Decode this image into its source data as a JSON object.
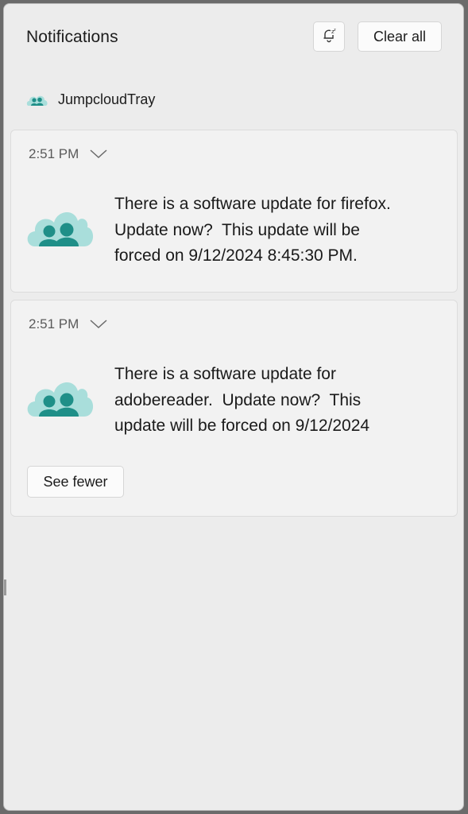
{
  "header": {
    "title": "Notifications",
    "clear_all_label": "Clear all",
    "dnd_icon": "snooze-bell-icon"
  },
  "app": {
    "name": "JumpcloudTray",
    "icon": "jumpcloud-icon",
    "accent_color": "#2fa29a"
  },
  "notifications": [
    {
      "time": "2:51 PM",
      "message": "There is a software update for firefox.\nUpdate now?  This update will be\nforced on 9/12/2024 8:45:30 PM."
    },
    {
      "time": "2:51 PM",
      "message": "There is a software update for\nadobereader.  Update now?  This\nupdate will be forced on 9/12/2024",
      "see_fewer_label": "See fewer"
    }
  ]
}
